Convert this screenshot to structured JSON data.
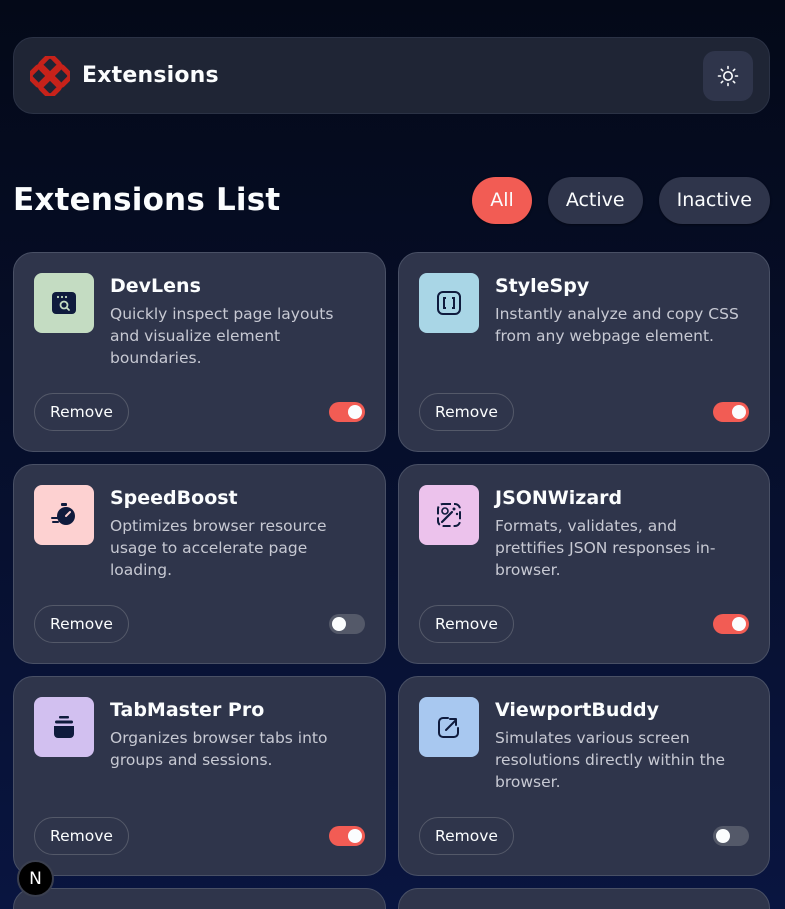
{
  "header": {
    "title": "Extensions",
    "theme_icon": "sun-icon"
  },
  "main": {
    "title": "Extensions List",
    "filters": [
      {
        "label": "All",
        "active": true
      },
      {
        "label": "Active",
        "active": false
      },
      {
        "label": "Inactive",
        "active": false
      }
    ]
  },
  "extensions": [
    {
      "name": "DevLens",
      "description": "Quickly inspect page layouts and visualize element boundaries.",
      "icon": "devlens-icon",
      "icon_bg": "#c4dcc2",
      "enabled": true,
      "remove_label": "Remove"
    },
    {
      "name": "StyleSpy",
      "description": "Instantly analyze and copy CSS from any webpage element.",
      "icon": "stylespy-icon",
      "icon_bg": "#a9d6e6",
      "enabled": true,
      "remove_label": "Remove"
    },
    {
      "name": "SpeedBoost",
      "description": "Optimizes browser resource usage to accelerate page loading.",
      "icon": "speedboost-icon",
      "icon_bg": "#fdd1d1",
      "enabled": false,
      "remove_label": "Remove"
    },
    {
      "name": "JSONWizard",
      "description": "Formats, validates, and prettifies JSON responses in-browser.",
      "icon": "jsonwizard-icon",
      "icon_bg": "#ecc2ec",
      "enabled": true,
      "remove_label": "Remove"
    },
    {
      "name": "TabMaster Pro",
      "description": "Organizes browser tabs into groups and sessions.",
      "icon": "tabmaster-icon",
      "icon_bg": "#d2c0f0",
      "enabled": true,
      "remove_label": "Remove"
    },
    {
      "name": "ViewportBuddy",
      "description": "Simulates various screen resolutions directly within the browser.",
      "icon": "viewportbuddy-icon",
      "icon_bg": "#a8c8f0",
      "enabled": false,
      "remove_label": "Remove"
    }
  ],
  "dev_badge": {
    "label": "N"
  },
  "colors": {
    "accent": "#f25c54",
    "card": "#2f354b",
    "background": "#091540"
  }
}
